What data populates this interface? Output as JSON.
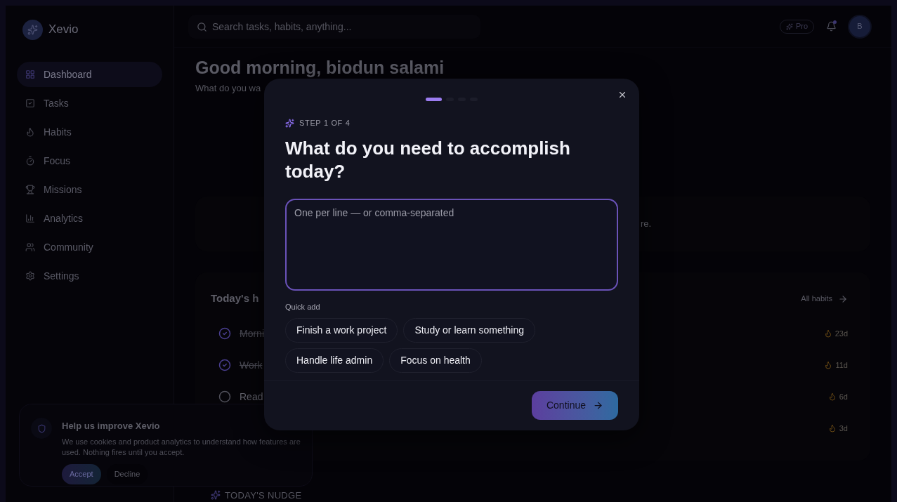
{
  "brand": {
    "name": "Xevio"
  },
  "sidebar": {
    "items": [
      {
        "label": "Dashboard",
        "selected": true
      },
      {
        "label": "Tasks",
        "selected": false
      },
      {
        "label": "Habits",
        "selected": false
      },
      {
        "label": "Focus",
        "selected": false
      },
      {
        "label": "Missions",
        "selected": false
      },
      {
        "label": "Analytics",
        "selected": false
      },
      {
        "label": "Community",
        "selected": false
      },
      {
        "label": "Settings",
        "selected": false
      }
    ]
  },
  "topbar": {
    "search": {
      "placeholder": "Search tasks, habits, anything..."
    },
    "pro_badge": "Pro",
    "notification": true,
    "avatar": "B"
  },
  "greeting": {
    "title": "Good morning, biodun salami",
    "subtitle": "What do you wa"
  },
  "banner_card": {
    "text_tail": "re."
  },
  "habits": {
    "title": "Today's h",
    "link": "All habits",
    "rows": [
      {
        "name": "Morni",
        "done": true,
        "streak": "23d"
      },
      {
        "name": "Work",
        "done": true,
        "streak": "11d"
      },
      {
        "name": "Read",
        "done": false,
        "streak": "6d"
      },
      {
        "streak": "3d"
      }
    ]
  },
  "nudge": {
    "label": "TODAY'S NUDGE"
  },
  "cookie": {
    "title": "Help us improve Xevio",
    "text": "We use cookies and product analytics to understand how features are used. Nothing fires until you accept.",
    "buttons": [
      {
        "label": "Accept",
        "kind": "primary"
      },
      {
        "label": "Decline",
        "kind": "secondary"
      }
    ]
  },
  "modal": {
    "steps": [
      {
        "selected": true
      },
      {
        "selected": false
      },
      {
        "selected": false
      },
      {
        "selected": false
      }
    ],
    "step_label": "STEP 1 OF 4",
    "title": "What do you need to accomplish today?",
    "input": {
      "placeholder": "One per line — or comma-separated"
    },
    "quick_add_label": "Quick add",
    "chips": [
      "Finish a work project",
      "Study or learn something",
      "Handle life admin",
      "Focus on health"
    ],
    "continue": "Continue"
  }
}
